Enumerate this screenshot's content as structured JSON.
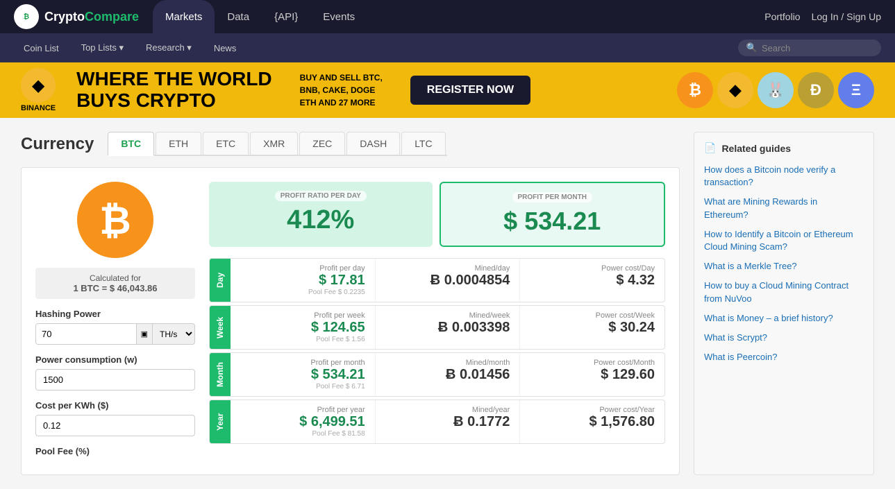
{
  "logo": {
    "icon": "₿",
    "text_dark": "Crypto",
    "text_light": "Compare"
  },
  "nav": {
    "tabs": [
      {
        "label": "Markets",
        "active": true
      },
      {
        "label": "Data",
        "active": false
      },
      {
        "label": "{API}",
        "active": false
      },
      {
        "label": "Events",
        "active": false
      }
    ],
    "right_links": [
      {
        "label": "Portfolio"
      },
      {
        "label": "Log In / Sign Up"
      }
    ]
  },
  "sec_nav": {
    "items": [
      {
        "label": "Coin List",
        "has_arrow": false
      },
      {
        "label": "Top Lists ▾",
        "has_arrow": true
      },
      {
        "label": "Research ▾",
        "has_arrow": true
      },
      {
        "label": "News",
        "has_arrow": false
      }
    ],
    "search_placeholder": "Search"
  },
  "banner": {
    "logo_symbol": "◆",
    "logo_name": "BINANCE",
    "headline_line1": "WHERE THE WORLD",
    "headline_line2": "BUYS CRYPTO",
    "sub_text": "BUY AND SELL BTC,\nBNB, CAKE, DOGE\nETH AND 27 MORE",
    "cta": "REGISTER NOW"
  },
  "currency": {
    "title": "Currency",
    "tabs": [
      "BTC",
      "ETH",
      "ETC",
      "XMR",
      "ZEC",
      "DASH",
      "LTC"
    ],
    "active_tab": "BTC"
  },
  "calculator": {
    "btc_icon": "₿",
    "calculated_for_label": "Calculated for",
    "rate": "1 BTC = $ 46,043.86",
    "hashing_power_label": "Hashing Power",
    "hashing_power_value": "70",
    "hashing_power_unit": "TH/s",
    "power_consumption_label": "Power consumption (w)",
    "power_consumption_value": "1500",
    "cost_per_kwh_label": "Cost per KWh ($)",
    "cost_per_kwh_value": "0.12",
    "pool_fee_label": "Pool Fee (%)"
  },
  "profit_summary": {
    "day_label": "PROFIT RATIO PER DAY",
    "day_value": "412%",
    "month_label": "PROFIT PER MONTH",
    "month_value": "$ 534.21"
  },
  "rows": [
    {
      "period_label": "Day",
      "profit_label": "Profit per day",
      "profit_value": "$ 17.81",
      "pool_fee": "Pool Fee $ 0.2235",
      "mined_label": "Mined/day",
      "mined_value": "Ƀ 0.0004854",
      "power_label": "Power cost/Day",
      "power_value": "$ 4.32"
    },
    {
      "period_label": "Week",
      "profit_label": "Profit per week",
      "profit_value": "$ 124.65",
      "pool_fee": "Pool Fee $ 1.56",
      "mined_label": "Mined/week",
      "mined_value": "Ƀ 0.003398",
      "power_label": "Power cost/Week",
      "power_value": "$ 30.24"
    },
    {
      "period_label": "Month",
      "profit_label": "Profit per month",
      "profit_value": "$ 534.21",
      "pool_fee": "Pool Fee $ 6.71",
      "mined_label": "Mined/month",
      "mined_value": "Ƀ 0.01456",
      "power_label": "Power cost/Month",
      "power_value": "$ 129.60"
    },
    {
      "period_label": "Year",
      "profit_label": "Profit per year",
      "profit_value": "$ 6,499.51",
      "pool_fee": "Pool Fee $ 81.58",
      "mined_label": "Mined/year",
      "mined_value": "Ƀ 0.1772",
      "power_label": "Power cost/Year",
      "power_value": "$ 1,576.80"
    }
  ],
  "related_guides": {
    "title": "Related guides",
    "links": [
      "How does a Bitcoin node verify a transaction?",
      "What are Mining Rewards in Ethereum?",
      "How to Identify a Bitcoin or Ethereum Cloud Mining Scam?",
      "What is a Merkle Tree?",
      "How to buy a Cloud Mining Contract from NuVoo",
      "What is Money – a brief history?",
      "What is Scrypt?",
      "What is Peercoin?"
    ]
  }
}
